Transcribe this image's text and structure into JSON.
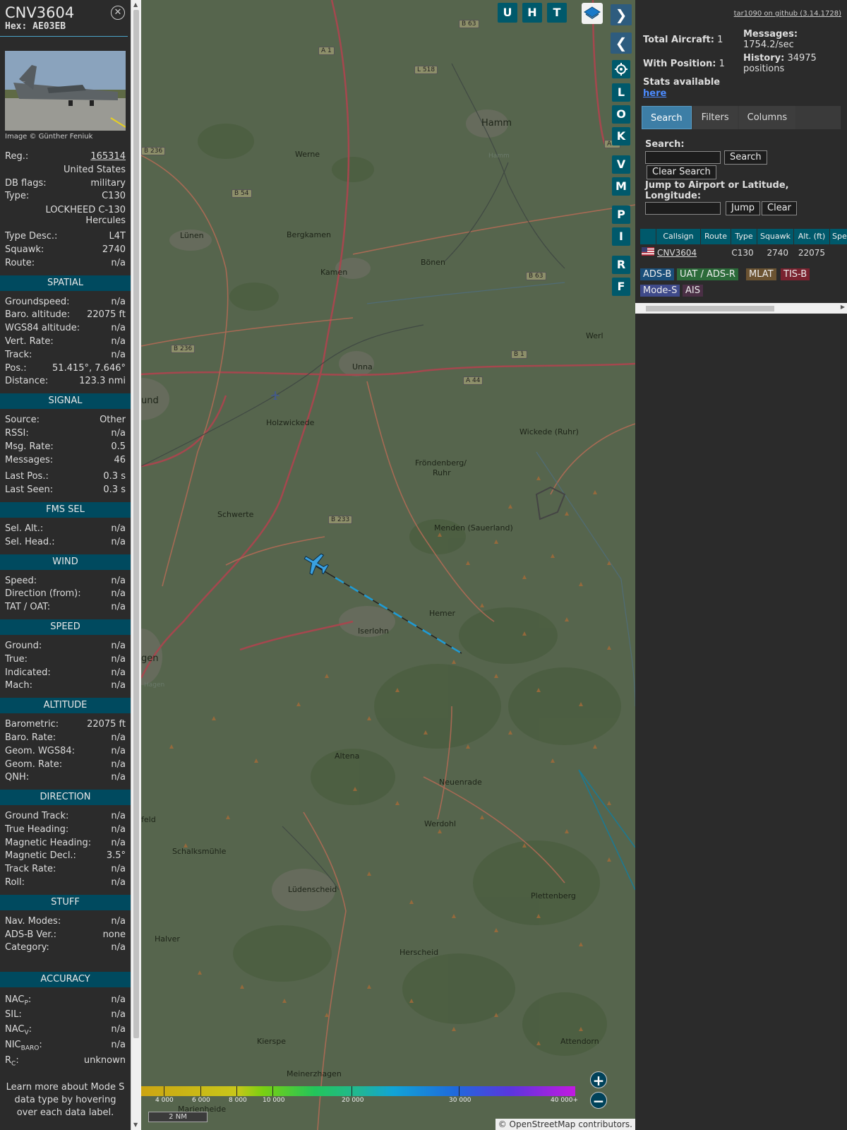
{
  "aircraft": {
    "callsign": "CNV3604",
    "hex_label": "Hex:",
    "hex": "AE03EB",
    "image_credit": "Image © Günther Feniuk",
    "reg_label": "Reg.:",
    "reg": "165314",
    "country": "United States",
    "dbflags_label": "DB flags:",
    "dbflags": "military",
    "type_label": "Type:",
    "type": "C130",
    "type_full_1": "LOCKHEED C-130",
    "type_full_2": "Hercules",
    "typedesc_label": "Type Desc.:",
    "typedesc": "L4T",
    "squawk_label": "Squawk:",
    "squawk": "2740",
    "route_label": "Route:",
    "route": "n/a"
  },
  "sections": {
    "spatial": "SPATIAL",
    "signal": "SIGNAL",
    "fmssel": "FMS SEL",
    "wind": "WIND",
    "speed": "SPEED",
    "altitude": "ALTITUDE",
    "direction": "DIRECTION",
    "stuff": "STUFF",
    "accuracy": "ACCURACY"
  },
  "spatial": [
    {
      "k": "Groundspeed:",
      "v": "n/a"
    },
    {
      "k": "Baro. altitude:",
      "v": "22075 ft"
    },
    {
      "k": "WGS84 altitude:",
      "v": "n/a"
    },
    {
      "k": "Vert. Rate:",
      "v": "n/a"
    },
    {
      "k": "Track:",
      "v": "n/a"
    },
    {
      "k": "Pos.:",
      "v": "51.415°, 7.646°"
    },
    {
      "k": "Distance:",
      "v": "123.3 nmi"
    }
  ],
  "signal": [
    {
      "k": "Source:",
      "v": "Other"
    },
    {
      "k": "RSSI:",
      "v": "n/a"
    },
    {
      "k": "Msg. Rate:",
      "v": "0.5"
    },
    {
      "k": "Messages:",
      "v": "46"
    },
    {
      "k": "Last Pos.:",
      "v": "0.3 s"
    },
    {
      "k": "Last Seen:",
      "v": "0.3 s"
    }
  ],
  "fmssel": [
    {
      "k": "Sel. Alt.:",
      "v": "n/a"
    },
    {
      "k": "Sel. Head.:",
      "v": "n/a"
    }
  ],
  "wind": [
    {
      "k": "Speed:",
      "v": "n/a"
    },
    {
      "k": "Direction (from):",
      "v": "n/a"
    },
    {
      "k": "TAT / OAT:",
      "v": "n/a"
    }
  ],
  "speed": [
    {
      "k": "Ground:",
      "v": "n/a"
    },
    {
      "k": "True:",
      "v": "n/a"
    },
    {
      "k": "Indicated:",
      "v": "n/a"
    },
    {
      "k": "Mach:",
      "v": "n/a"
    }
  ],
  "altitude": [
    {
      "k": "Barometric:",
      "v": "22075 ft"
    },
    {
      "k": "Baro. Rate:",
      "v": "n/a"
    },
    {
      "k": "Geom. WGS84:",
      "v": "n/a"
    },
    {
      "k": "Geom. Rate:",
      "v": "n/a"
    },
    {
      "k": "QNH:",
      "v": "n/a"
    }
  ],
  "direction": [
    {
      "k": "Ground Track:",
      "v": "n/a"
    },
    {
      "k": "True Heading:",
      "v": "n/a"
    },
    {
      "k": "Magnetic Heading:",
      "v": "n/a"
    },
    {
      "k": "Magnetic Decl.:",
      "v": "3.5°"
    },
    {
      "k": "Track Rate:",
      "v": "n/a"
    },
    {
      "k": "Roll:",
      "v": "n/a"
    }
  ],
  "stuff": [
    {
      "k": "Nav. Modes:",
      "v": "n/a"
    },
    {
      "k": "ADS-B Ver.:",
      "v": "none"
    },
    {
      "k": "Category:",
      "v": "n/a"
    }
  ],
  "accuracy": {
    "nacp_main": "NAC",
    "nacp_sub": "P",
    "nacp_v": "n/a",
    "sil_k": "SIL:",
    "sil_v": "n/a",
    "nacv_main": "NAC",
    "nacv_sub": "V",
    "nacv_v": "n/a",
    "nic_main": "NIC",
    "nic_sub": "BARO",
    "nic_v": "n/a",
    "rc_main": "R",
    "rc_sub": "C",
    "rc_v": "unknown"
  },
  "learn_more": "Learn more about Mode S data type by hovering over each data label.",
  "map": {
    "buttons_top": [
      "U",
      "H",
      "T"
    ],
    "buttons_side": [
      "L",
      "O",
      "K",
      "V",
      "M",
      "P",
      "I",
      "R",
      "F"
    ],
    "nav_next": "❯",
    "nav_prev": "❮",
    "expand": "◂▸",
    "zoom_in": "+",
    "zoom_out": "−",
    "scale": "2 NM",
    "attribution": "© OpenStreetMap contributors.",
    "altitude_legend": [
      "4 000",
      "6 000",
      "8 000",
      "10 000",
      "20 000",
      "30 000",
      "40 000+"
    ],
    "towns": [
      "Hamm",
      "Werne",
      "Lünen",
      "Bergkamen",
      "Kamen",
      "Bönen",
      "Unna",
      "Werl",
      "Holzwickede",
      "Wickede (Ruhr)",
      "Fröndenberg/",
      "Ruhr",
      "Schwerte",
      "Menden (Sauerland)",
      "Hemer",
      "Iserlohn",
      "Altena",
      "Neuenrade",
      "Werdohl",
      "Schalksmühle",
      "Lüdenscheid",
      "Plettenberg",
      "Halver",
      "Herscheid",
      "Kierspe",
      "Meinerzhagen",
      "Attendorn",
      "und",
      "gen",
      "feld",
      "Marienheide",
      "Hagen",
      "Hamm"
    ],
    "roads": [
      "B 63",
      "A 1",
      "L 518",
      "B 236",
      "B 54",
      "B 63",
      "B 236",
      "B 1",
      "A 44",
      "B 233",
      "A 1"
    ]
  },
  "sidebar": {
    "github": "tar1090 on github (3.14.1728)",
    "total_label": "Total Aircraft:",
    "total": "1",
    "withpos_label": "With Position:",
    "withpos": "1",
    "messages_label": "Messages:",
    "messages": "1754.2/sec",
    "history_label": "History:",
    "history": "34975",
    "history_unit": "positions",
    "stats_label": "Stats available",
    "stats_link": "here",
    "tabs": [
      "Search",
      "Filters",
      "Columns"
    ],
    "search_label": "Search:",
    "search_button": "Search",
    "clear_search": "Clear Search",
    "jump_label_1": "Jump to Airport or Latitude,",
    "jump_label_2": "Longitude:",
    "jump_button": "Jump",
    "clear_button": "Clear",
    "columns": [
      "",
      "Callsign",
      "Route",
      "Type",
      "Squawk",
      "Alt. (ft)",
      "Spe"
    ],
    "row": {
      "callsign": "CNV3604",
      "route": "",
      "type": "C130",
      "squawk": "2740",
      "alt": "22075"
    },
    "sources": [
      {
        "label": "ADS-B",
        "color": "#1a4f7a"
      },
      {
        "label": "UAT / ADS-R",
        "color": "#2c6b3a"
      },
      {
        "label": "MLAT",
        "color": "#6b5332"
      },
      {
        "label": "TIS-B",
        "color": "#7a2330"
      },
      {
        "label": "Mode-S",
        "color": "#3f4a8a"
      },
      {
        "label": "AIS",
        "color": "#4a2f45"
      }
    ]
  }
}
